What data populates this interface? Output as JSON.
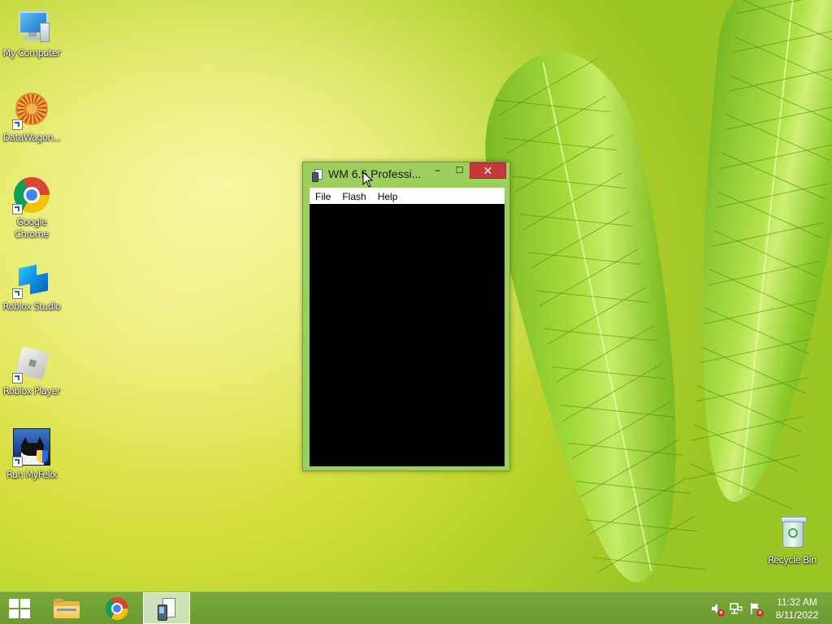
{
  "desktop": {
    "icons": [
      {
        "label": "My Computer"
      },
      {
        "label": "DataWagon..."
      },
      {
        "label": "Google Chrome"
      },
      {
        "label": "Roblox Studio"
      },
      {
        "label": "Roblox Player"
      },
      {
        "label": "Run MyFelix"
      },
      {
        "label": "Recycle Bin"
      }
    ]
  },
  "window": {
    "title": "WM 6.5 Professi...",
    "minimize": "–",
    "maximize": "☐",
    "close": "✕",
    "menu": [
      "File",
      "Flash",
      "Help"
    ]
  },
  "taskbar": {
    "clock_time": "11:32 AM",
    "clock_date": "8/11/2022"
  },
  "colors": {
    "close_button": "#c7383c",
    "window_frame": "#9ccf5e",
    "taskbar": "#6a9a30"
  }
}
